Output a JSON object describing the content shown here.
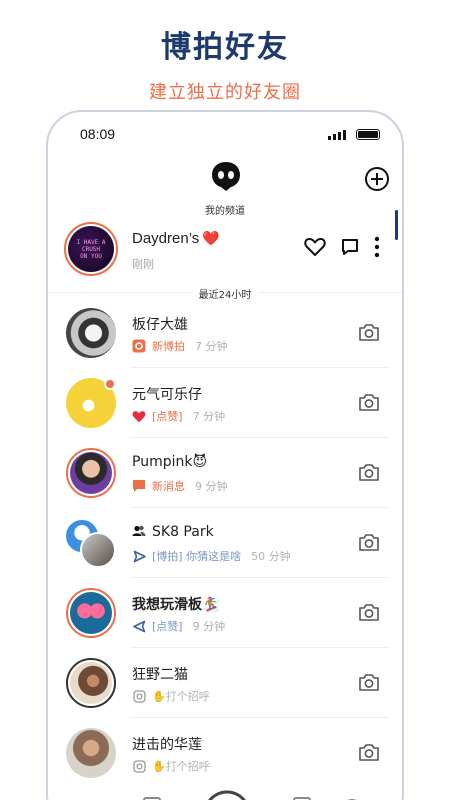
{
  "promo": {
    "title": "博拍好友",
    "subtitle": "建立独立的好友圈"
  },
  "status_bar": {
    "time": "08:09"
  },
  "sections": {
    "my_channel": "我的频道",
    "recent": "最近24小时"
  },
  "channel": {
    "name": "Daydren’s",
    "name_emoji": "❤️",
    "sub": "刚刚",
    "avatar_text": [
      "I HAVE A",
      "CRUSH",
      "ON YOU"
    ],
    "icons": [
      "heart-outline-icon",
      "comment-icon",
      "more-vertical-icon"
    ]
  },
  "friends": [
    {
      "name": "板仔大雄",
      "status_icon": "record-icon",
      "status_text": "新博拍",
      "status_color": "#ee6e47",
      "time": "7 分钟",
      "ring": false,
      "dot": false,
      "bold": false
    },
    {
      "name": "元气可乐仔",
      "status_icon": "heart-filled-icon",
      "status_text": "[点赞]",
      "status_color": "#ee6e47",
      "time": "7 分钟",
      "ring": false,
      "dot": true,
      "bold": false
    },
    {
      "name": "Pumpink😈",
      "status_icon": "chat-filled-icon",
      "status_text": "新消息",
      "status_color": "#ee6e47",
      "time": "9 分钟",
      "ring": true,
      "dot": false,
      "bold": false
    },
    {
      "name": "SK8 Park",
      "group_icon": "group-icon",
      "status_icon": "send-icon",
      "status_text": "[博拍] 你猜这是啥",
      "status_color": "#7a98c4",
      "time": "50 分钟",
      "ring": false,
      "dot": false,
      "bold": false
    },
    {
      "name": "我想玩滑板🏂",
      "status_icon": "send-left-icon",
      "status_text": "[点赞]",
      "status_color": "#7a98c4",
      "time": "9 分钟",
      "ring": true,
      "dot": false,
      "bold": true
    },
    {
      "name": "狂野二猫",
      "status_icon": "instagram-icon",
      "status_text": "✋打个招呼",
      "status_color": "#b0b0b0",
      "time": "",
      "ring": true,
      "dot": false,
      "bold": false
    },
    {
      "name": "进击的华莲",
      "status_icon": "instagram-icon",
      "status_text": "✋打个招呼",
      "status_color": "#b0b0b0",
      "time": "",
      "ring": false,
      "dot": false,
      "bold": false
    }
  ],
  "colors": {
    "brand_navy": "#1d3a6e",
    "accent_orange": "#ee6e47",
    "muted_blue": "#7a98c4"
  }
}
